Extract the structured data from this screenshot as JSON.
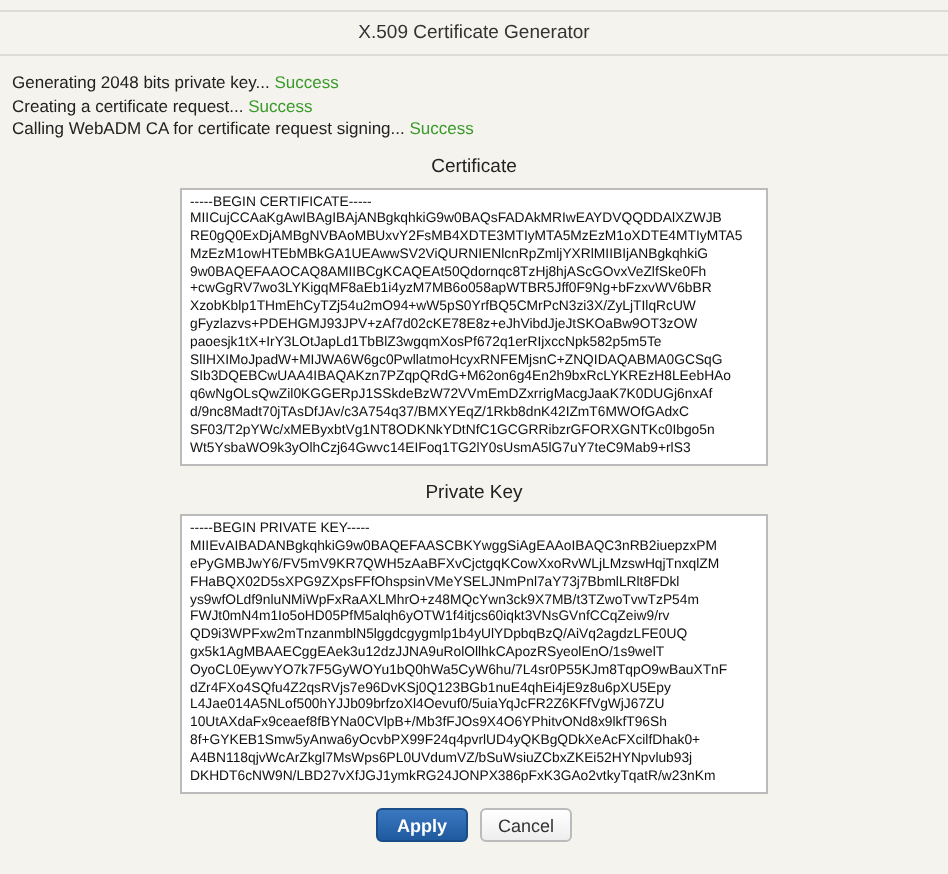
{
  "window": {
    "title": "X.509 Certificate Generator"
  },
  "log": [
    {
      "text": "Generating 2048 bits private key...",
      "status": "Success"
    },
    {
      "text": "Creating a certificate request...",
      "status": "Success"
    },
    {
      "text": "Calling WebADM CA for certificate request signing...",
      "status": "Success"
    }
  ],
  "sections": [
    {
      "label": "Certificate",
      "lines": [
        "-----BEGIN CERTIFICATE-----",
        "MIICujCCAaKgAwIBAgIBAjANBgkqhkiG9w0BAQsFADAkMRIwEAYDVQQDDAlXZWJB",
        "RE0gQ0ExDjAMBgNVBAoMBUxvY2FsMB4XDTE3MTIyMTA5MzEzM1oXDTE4MTIyMTA5",
        "MzEzM1owHTEbMBkGA1UEAwwSV2ViQURNIENlcnRpZmljYXRlMIIBIjANBgkqhkiG",
        "9w0BAQEFAAOCAQ8AMIIBCgKCAQEAt50Qdornqc8TzHj8hjAScGOvxVeZlfSke0Fh",
        "+cwGgRV7wo3LYKigqMF8aEb1i4yzM7MB6o058apWTBR5Jff0F9Ng+bFzxvWV6bBR",
        "XzobKblp1THmEhCyTZj54u2mO94+wW5pS0YrfBQ5CMrPcN3zi3X/ZyLjTIlqRcUW",
        "gFyzlazvs+PDEHGMJ93JPV+zAf7d02cKE78E8z+eJhVibdJjeJtSKOaBw9OT3zOW",
        "paoesjk1tX+IrY3LOtJapLd1TbBlZ3wgqmXosPf672q1erRIjxccNpk582p5m5Te",
        "SlIHXIMoJpadW+MIJWA6W6gc0PwllatmoHcyxRNFEMjsnC+ZNQIDAQABMA0GCSqG",
        "SIb3DQEBCwUAA4IBAQAKzn7PZqpQRdG+M62on6g4En2h9bxRcLYKREzH8LEebHAo",
        "q6wNgOLsQwZil0KGGERpJ1SSkdeBzW72VVmEmDZxrrigMacgJaaK7K0DUGj6nxAf",
        "d/9nc8Madt70jTAsDfJAv/c3A754q37/BMXYEqZ/1Rkb8dnK42IZmT6MWOfGAdxC",
        "SF03/T2pYWc/xMEByxbtVg1NT8ODKNkYDtNfC1GCGRRibzrGFORXGNTKc0Ibgo5n",
        "Wt5YsbaWO9k3yOlhCzj64Gwvc14EIFoq1TG2lY0sUsmA5lG7uY7teC9Mab9+rlS3"
      ]
    },
    {
      "label": "Private Key",
      "lines": [
        "-----BEGIN PRIVATE KEY-----",
        "MIIEvAIBADANBgkqhkiG9w0BAQEFAASCBKYwggSiAgEAAoIBAQC3nRB2iuepzxPM",
        "ePyGMBJwY6/FV5mV9KR7QWH5zAaBFXvCjctgqKCowXxoRvWLjLMzswHqjTnxqlZM",
        "FHaBQX02D5sXPG9ZXpsFFfOhspsinVMeYSELJNmPnl7aY73j7BbmlLRlt8FDkl",
        "ys9wfOLdf9nluNMiWpFxRaAXLMhrO+z48MQcYwn3ck9X7MB/t3TZwoTvwTzP54m",
        "FWJt0mN4m1Io5oHD05PfM5alqh6yOTW1f4itjcs60iqkt3VNsGVnfCCqZeiw9/rv",
        "QD9i3WPFxw2mTnzanmblN5lggdcgygmlp1b4yUlYDpbqBzQ/AiVq2agdzLFE0UQ",
        "gx5k1AgMBAAECggEAek3u12dzJJNA9uRolOllhkCApozRSyeolEnO/1s9welT",
        "OyoCL0EywvYO7k7F5GyWOYu1bQ0hWa5CyW6hu/7L4sr0P55KJm8TqpO9wBauXTnF",
        "dZr4FXo4SQfu4Z2qsRVjs7e96DvKSj0Q123BGb1nuE4qhEi4jE9z8u6pXU5Epy",
        "L4Jae014A5NLof500hYJJb09brfzoXl4Oevuf0/5uiaYqJcFR2Z6KFfVgWjJ67ZU",
        "10UtAXdaFx9ceaef8fBYNa0CVlpB+/Mb3fFJOs9X4O6YPhitvONd8x9lkfT96Sh",
        "8f+GYKEB1Smw5yAnwa6yOcvbPX99F24q4pvrlUD4yQKBgQDkXeAcFXcilfDhak0+",
        "A4BN118qjvWcArZkgl7MsWps6PL0UVdumVZ/bSuWsiuZCbxZKEi52HYNpvlub93j",
        "DKHDT6cNW9N/LBD27vXfJGJ1ymkRG24JONPX386pFxK3GAo2vtkyTqatR/w23nKm"
      ]
    }
  ],
  "buttons": [
    {
      "label": "Apply",
      "kind": "primary"
    },
    {
      "label": "Cancel",
      "kind": "secondary"
    }
  ]
}
